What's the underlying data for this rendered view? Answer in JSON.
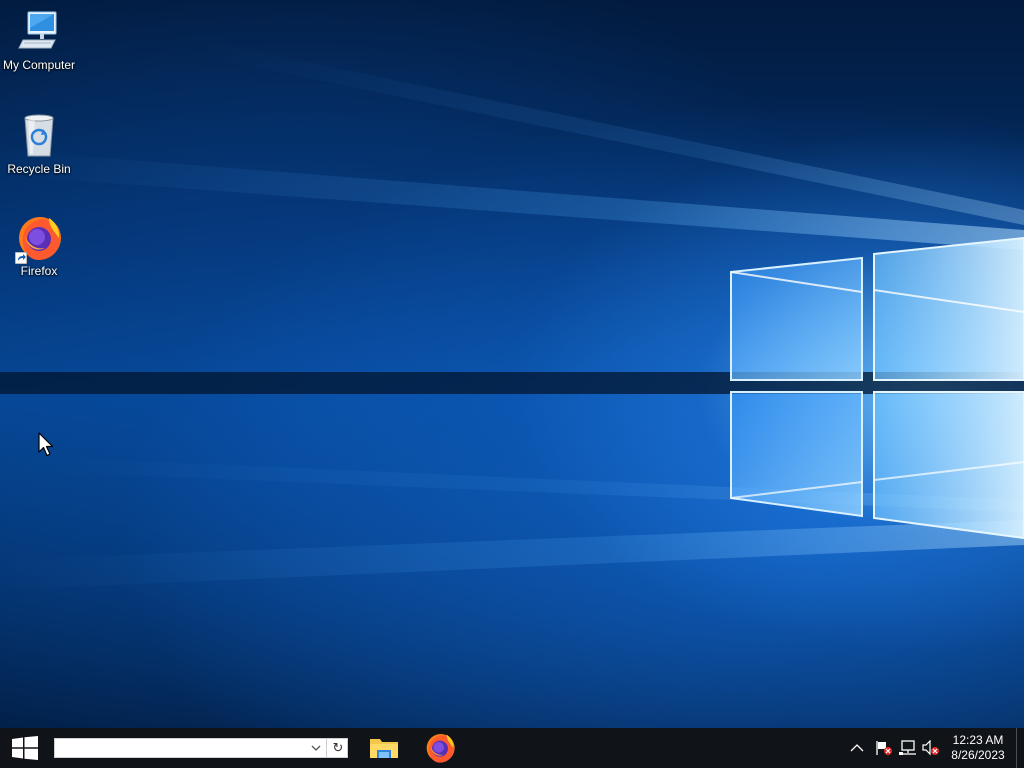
{
  "desktop": {
    "icons": [
      {
        "label": "My Computer",
        "icon": "computer-icon"
      },
      {
        "label": "Recycle Bin",
        "icon": "recycle-bin-icon"
      },
      {
        "label": "Firefox",
        "icon": "firefox-icon",
        "shortcut": true
      }
    ]
  },
  "taskbar": {
    "start_icon": "windows-logo-icon",
    "search": {
      "value": "",
      "placeholder": "",
      "dropdown_icon": "chevron-down-icon",
      "refresh_glyph": "↻"
    },
    "pinned_apps": [
      {
        "name": "File Explorer",
        "icon": "folder-icon"
      },
      {
        "name": "Firefox",
        "icon": "firefox-icon"
      }
    ],
    "tray": {
      "icons": [
        "chevron-up-icon",
        "flag-icon",
        "network-icon",
        "volume-muted-icon"
      ],
      "time": "12:23 AM",
      "date": "8/26/2023"
    }
  },
  "colors": {
    "taskbar_bg": "#101318",
    "desktop_accent": "#1f8fff",
    "error_badge": "#e02a2a"
  }
}
